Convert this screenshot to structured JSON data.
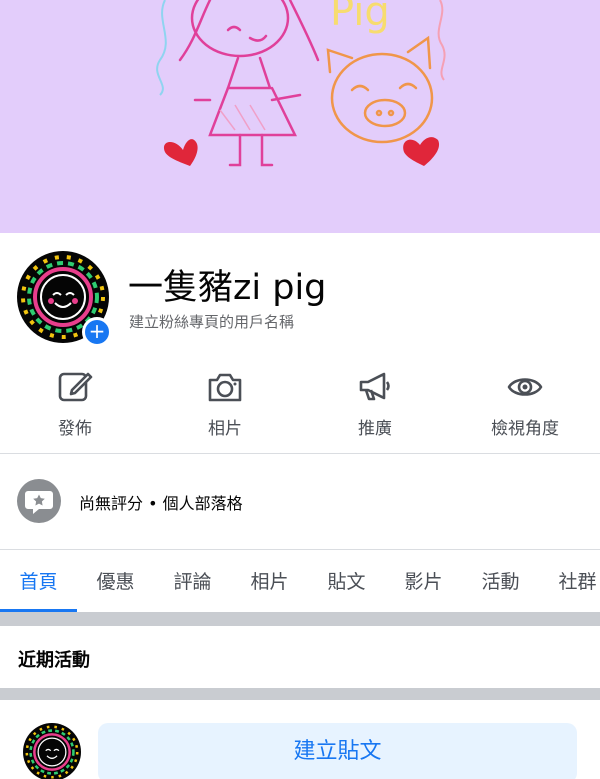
{
  "cover": {
    "drawing_text": "Pig",
    "background_color": "#e3cdfb"
  },
  "profile": {
    "page_name": "一隻豬zi pig",
    "username_hint": "建立粉絲專頁的用戶名稱",
    "add_photo_icon": "plus-icon"
  },
  "actions": [
    {
      "label": "發佈",
      "icon": "edit-icon"
    },
    {
      "label": "相片",
      "icon": "camera-icon"
    },
    {
      "label": "推廣",
      "icon": "megaphone-icon"
    },
    {
      "label": "檢視角度",
      "icon": "eye-icon"
    }
  ],
  "review": {
    "text": "尚無評分 • 個人部落格",
    "icon": "speech-bubble-star-icon"
  },
  "tabs": [
    {
      "label": "首頁",
      "active": true
    },
    {
      "label": "優惠"
    },
    {
      "label": "評論"
    },
    {
      "label": "相片"
    },
    {
      "label": "貼文"
    },
    {
      "label": "影片"
    },
    {
      "label": "活動"
    },
    {
      "label": "社群"
    }
  ],
  "recent": {
    "title": "近期活動"
  },
  "composer": {
    "create_post_label": "建立貼文"
  },
  "colors": {
    "accent": "#1877f2",
    "cover": "#e3cdfb"
  }
}
